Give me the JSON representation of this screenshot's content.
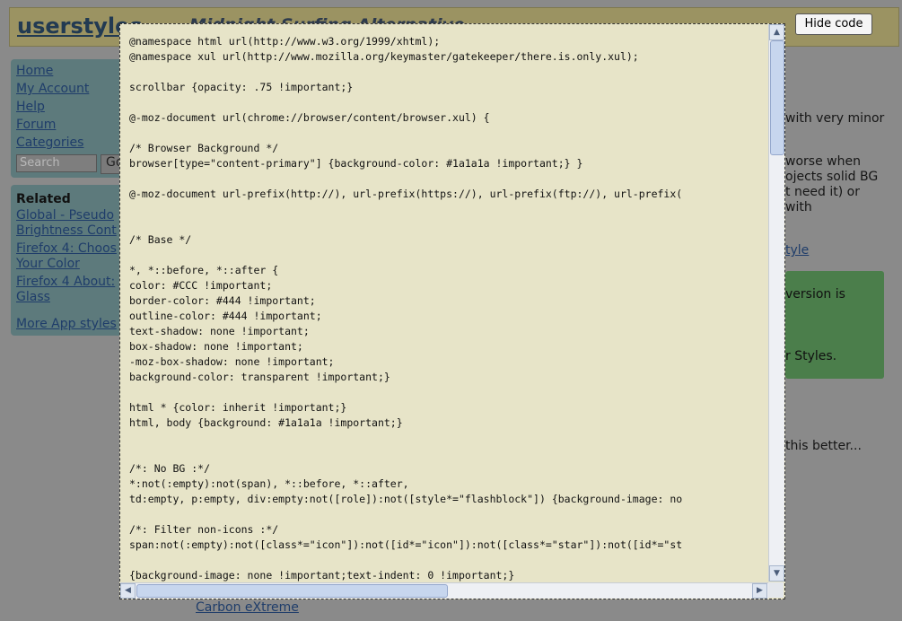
{
  "header": {
    "site_title": "userstyles",
    "page_title": "Midnight Surfing Alternative",
    "hide_button": "Hide code"
  },
  "nav": {
    "items": [
      {
        "label": "Home"
      },
      {
        "label": "My Account"
      },
      {
        "label": "Help"
      },
      {
        "label": "Forum"
      },
      {
        "label": "Categories"
      }
    ],
    "search_placeholder": "Search",
    "go_label": "Go"
  },
  "related": {
    "heading": "Related",
    "items": [
      {
        "label": "Global - Pseudo"
      },
      {
        "label": "Brightness Cont"
      },
      {
        "label": "Firefox 4: Choos"
      },
      {
        "label": "Your Color"
      },
      {
        "label": "Firefox 4 About:"
      },
      {
        "label": "Glass"
      }
    ],
    "more_label": "More App styles"
  },
  "right_column": {
    "lines": [
      "with very minor",
      "worse when",
      "ojects solid BG",
      "t need it) or",
      "with"
    ],
    "link": "tyle",
    "notice_lines": [
      "version is",
      "r Styles."
    ],
    "footer_text": "this better..."
  },
  "bottom_link": "Carbon eXtreme",
  "code": {
    "lines": [
      "@namespace html url(http://www.w3.org/1999/xhtml);",
      "@namespace xul url(http://www.mozilla.org/keymaster/gatekeeper/there.is.only.xul);",
      "",
      "scrollbar {opacity: .75 !important;}",
      "",
      "@-moz-document url(chrome://browser/content/browser.xul) {",
      "",
      "/* Browser Background */",
      "browser[type=\"content-primary\"] {background-color: #1a1a1a !important;} }",
      "",
      "@-moz-document url-prefix(http://), url-prefix(https://), url-prefix(ftp://), url-prefix(",
      "",
      "",
      "/* Base */",
      "",
      "*, *::before, *::after {",
      "color: #CCC !important;",
      "border-color: #444 !important;",
      "outline-color: #444 !important;",
      "text-shadow: none !important;",
      "box-shadow: none !important;",
      "-moz-box-shadow: none !important;",
      "background-color: transparent !important;}",
      "",
      "html * {color: inherit !important;}",
      "html, body {background: #1a1a1a !important;}",
      "",
      "",
      "/*: No BG :*/",
      "*:not(:empty):not(span), *::before, *::after,",
      "td:empty, p:empty, div:empty:not([role]):not([style*=\"flashblock\"]) {background-image: no",
      "",
      "/*: Filter non-icons :*/",
      "span:not(:empty):not([class*=\"icon\"]):not([id*=\"icon\"]):not([class*=\"star\"]):not([id*=\"st",
      "",
      "{background-image: none !important;text-indent: 0 !important;}"
    ]
  },
  "icons": {
    "scroll_up": "arrow-up-icon",
    "scroll_down": "arrow-down-icon",
    "scroll_left": "arrow-left-icon",
    "scroll_right": "arrow-right-icon"
  }
}
